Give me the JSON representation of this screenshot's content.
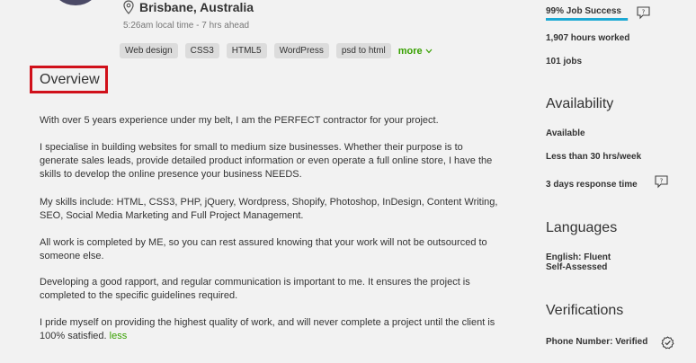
{
  "profile": {
    "location": "Brisbane, Australia",
    "local_time": "5:26am local time - 7 hrs ahead",
    "skills": [
      "Web design",
      "CSS3",
      "HTML5",
      "WordPress",
      "psd to html"
    ],
    "more_label": "more"
  },
  "overview": {
    "title": "Overview",
    "paragraphs": [
      "With over 5 years experience under my belt, I am the PERFECT contractor for your project.",
      "I specialise in building websites for small to medium size businesses. Whether their purpose is to generate sales leads, provide detailed product information or even operate a full online store, I have the skills to develop the online presence your business NEEDS.",
      "My skills include: HTML, CSS3, PHP, jQuery, Wordpress, Shopify, Photoshop, InDesign, Content Writing, SEO, Social Media Marketing and Full Project Management.",
      "All work is completed by ME, so you can rest assured knowing that your work will not be outsourced to someone else.",
      "Developing a good rapport, and regular communication is important to me. It ensures the project is completed to the specific guidelines required.",
      "I pride myself on providing the highest quality of work, and will never complete a project until the client is 100% satisfied."
    ],
    "less_label": "less"
  },
  "stats": {
    "job_success": "99% Job Success",
    "job_success_value": 0.99,
    "hours_worked": "1,907 hours worked",
    "jobs": "101 jobs"
  },
  "availability": {
    "heading": "Availability",
    "status": "Available",
    "hours": "Less than 30 hrs/week",
    "response_time": "3 days response time"
  },
  "languages": {
    "heading": "Languages",
    "item": "English: Fluent",
    "level": "Self-Assessed"
  },
  "verifications": {
    "heading": "Verifications",
    "phone": "Phone Number: Verified"
  },
  "colors": {
    "accent_green": "#37a000",
    "progress_blue": "#1da9d4",
    "highlight_red": "#d0101a"
  },
  "icons": [
    "map-pin-icon",
    "chevron-down-icon",
    "speech-bubble-icon",
    "verified-check-icon"
  ]
}
